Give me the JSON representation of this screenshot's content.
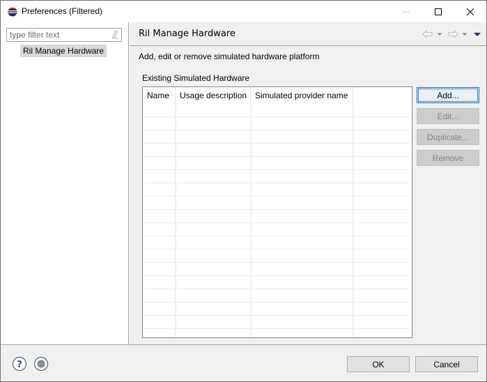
{
  "window": {
    "title": "Preferences (Filtered)",
    "controls": {
      "minimize": "minimize",
      "maximize": "maximize",
      "close": "close"
    }
  },
  "sidebar": {
    "filter": {
      "value": "",
      "placeholder": "type filter text"
    },
    "items": [
      {
        "label": "Ril Manage Hardware",
        "selected": true
      }
    ]
  },
  "page": {
    "title": "Ril Manage Hardware",
    "description": "Add, edit or remove simulated hardware platform",
    "group_label": "Existing Simulated Hardware",
    "table": {
      "columns": [
        "Name",
        "Usage description",
        "Simulated provider name",
        ""
      ],
      "rows": []
    },
    "buttons": {
      "add": "Add...",
      "edit": "Edit...",
      "duplicate": "Duplicate...",
      "remove": "Remove"
    }
  },
  "footer": {
    "ok": "OK",
    "cancel": "Cancel"
  },
  "colors": {
    "accent_focus": "#0078d7",
    "panel_bg": "#f0f0f0",
    "disabled_button": "#cccccc"
  }
}
